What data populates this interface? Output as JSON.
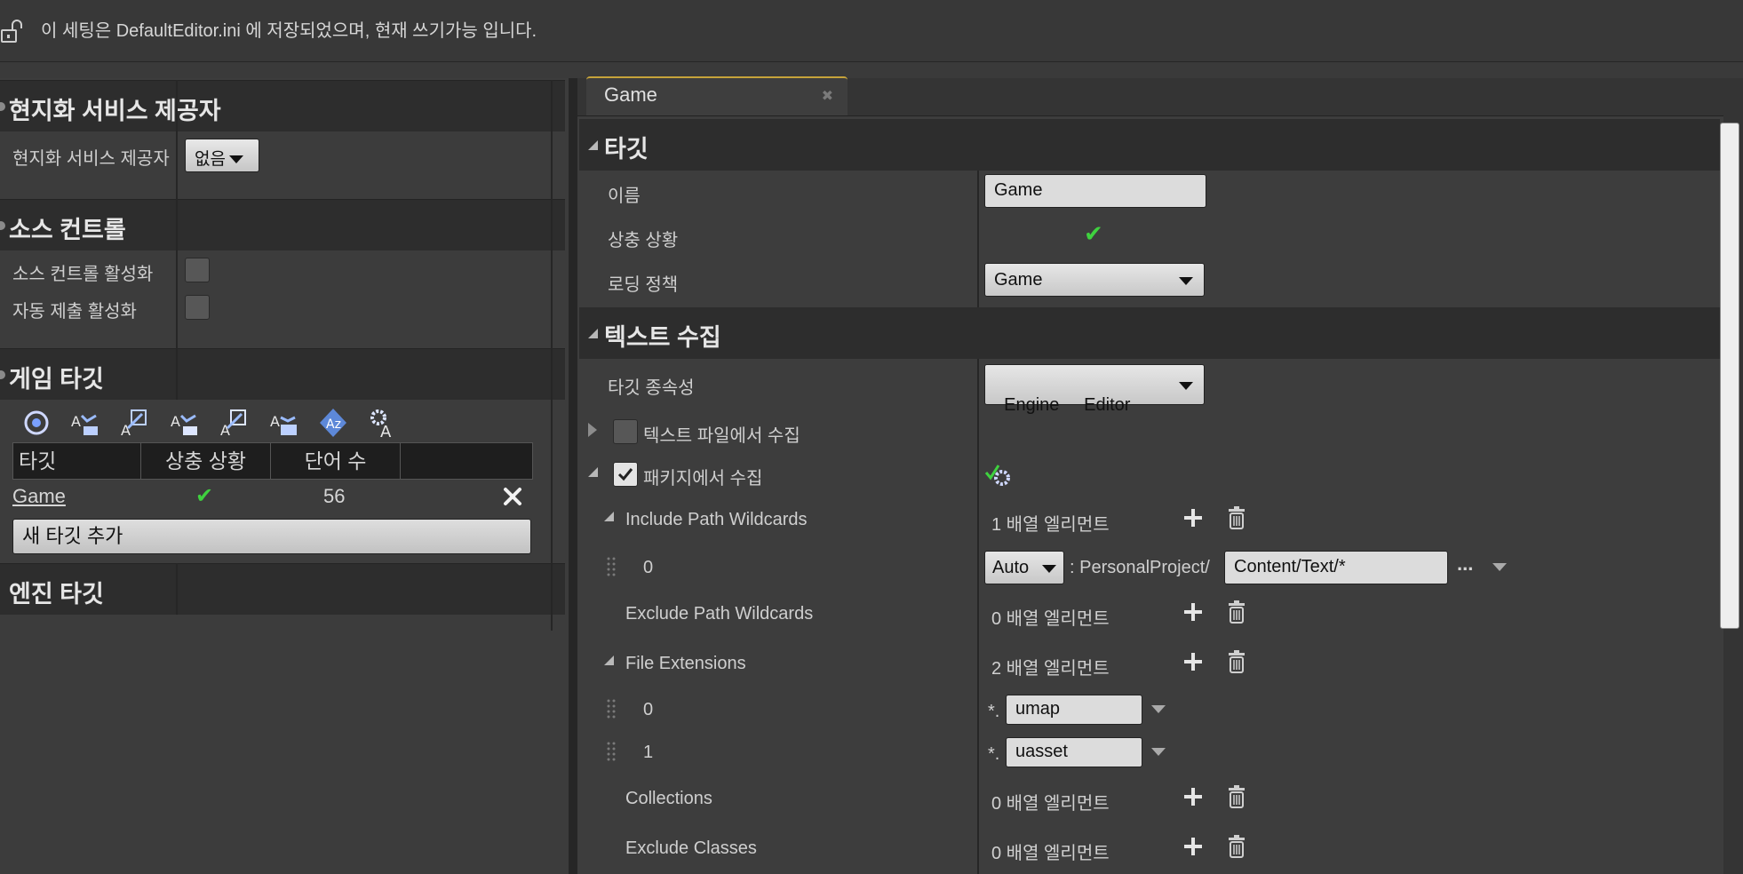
{
  "info_bar": {
    "text": "이 세팅은 DefaultEditor.ini 에 저장되었으며, 현재 쓰기가능 입니다."
  },
  "left_panel": {
    "loc_service": {
      "title": "현지화 서비스 제공자",
      "prop_label": "현지화 서비스 제공자",
      "value": "없음"
    },
    "source_control": {
      "title": "소스 컨트롤",
      "enable_label": "소스 컨트롤 활성화",
      "auto_submit_label": "자동 제출 활성화"
    },
    "game_targets": {
      "title": "게임 타깃",
      "columns": [
        "타깃",
        "상충 상황",
        "단어 수"
      ],
      "rows": [
        {
          "target": "Game",
          "conflict": "✔",
          "word_count": "56"
        }
      ],
      "add_button": "새 타깃 추가"
    },
    "engine_targets": {
      "title": "엔진 타깃"
    }
  },
  "right_panel": {
    "tab": {
      "label": "Game",
      "close": "✖"
    },
    "target_section": {
      "title": "타깃",
      "name_label": "이름",
      "name_value": "Game",
      "conflict_label": "상충 상황",
      "conflict_value": "✔",
      "loading_policy_label": "로딩 정책",
      "loading_policy_value": "Game"
    },
    "text_gather": {
      "title": "텍스트 수집",
      "target_deps_label": "타깃 종속성",
      "target_deps_value": "Engine     Editor",
      "gather_from_text_files": "텍스트 파일에서 수집",
      "gather_from_packages": "패키지에서 수집",
      "include_paths": {
        "label": "Include Path Wildcards",
        "count": "1 배열 엘리먼트",
        "item_index": "0",
        "root_combo": "Auto",
        "prefix": ": PersonalProject/",
        "value": "Content/Text/*",
        "more": "..."
      },
      "exclude_paths": {
        "label": "Exclude Path Wildcards",
        "count": "0 배열 엘리먼트"
      },
      "file_extensions": {
        "label": "File Extensions",
        "count": "2 배열 엘리먼트",
        "items": [
          {
            "index": "0",
            "prefix": "*.",
            "value": "umap"
          },
          {
            "index": "1",
            "prefix": "*.",
            "value": "uasset"
          }
        ]
      },
      "collections": {
        "label": "Collections",
        "count": "0 배열 엘리먼트"
      },
      "exclude_classes": {
        "label": "Exclude Classes",
        "count": "0 배열 엘리먼트"
      }
    }
  },
  "colors": {
    "check_green": "#3fd13f",
    "tab_accent": "#c6a33a"
  }
}
